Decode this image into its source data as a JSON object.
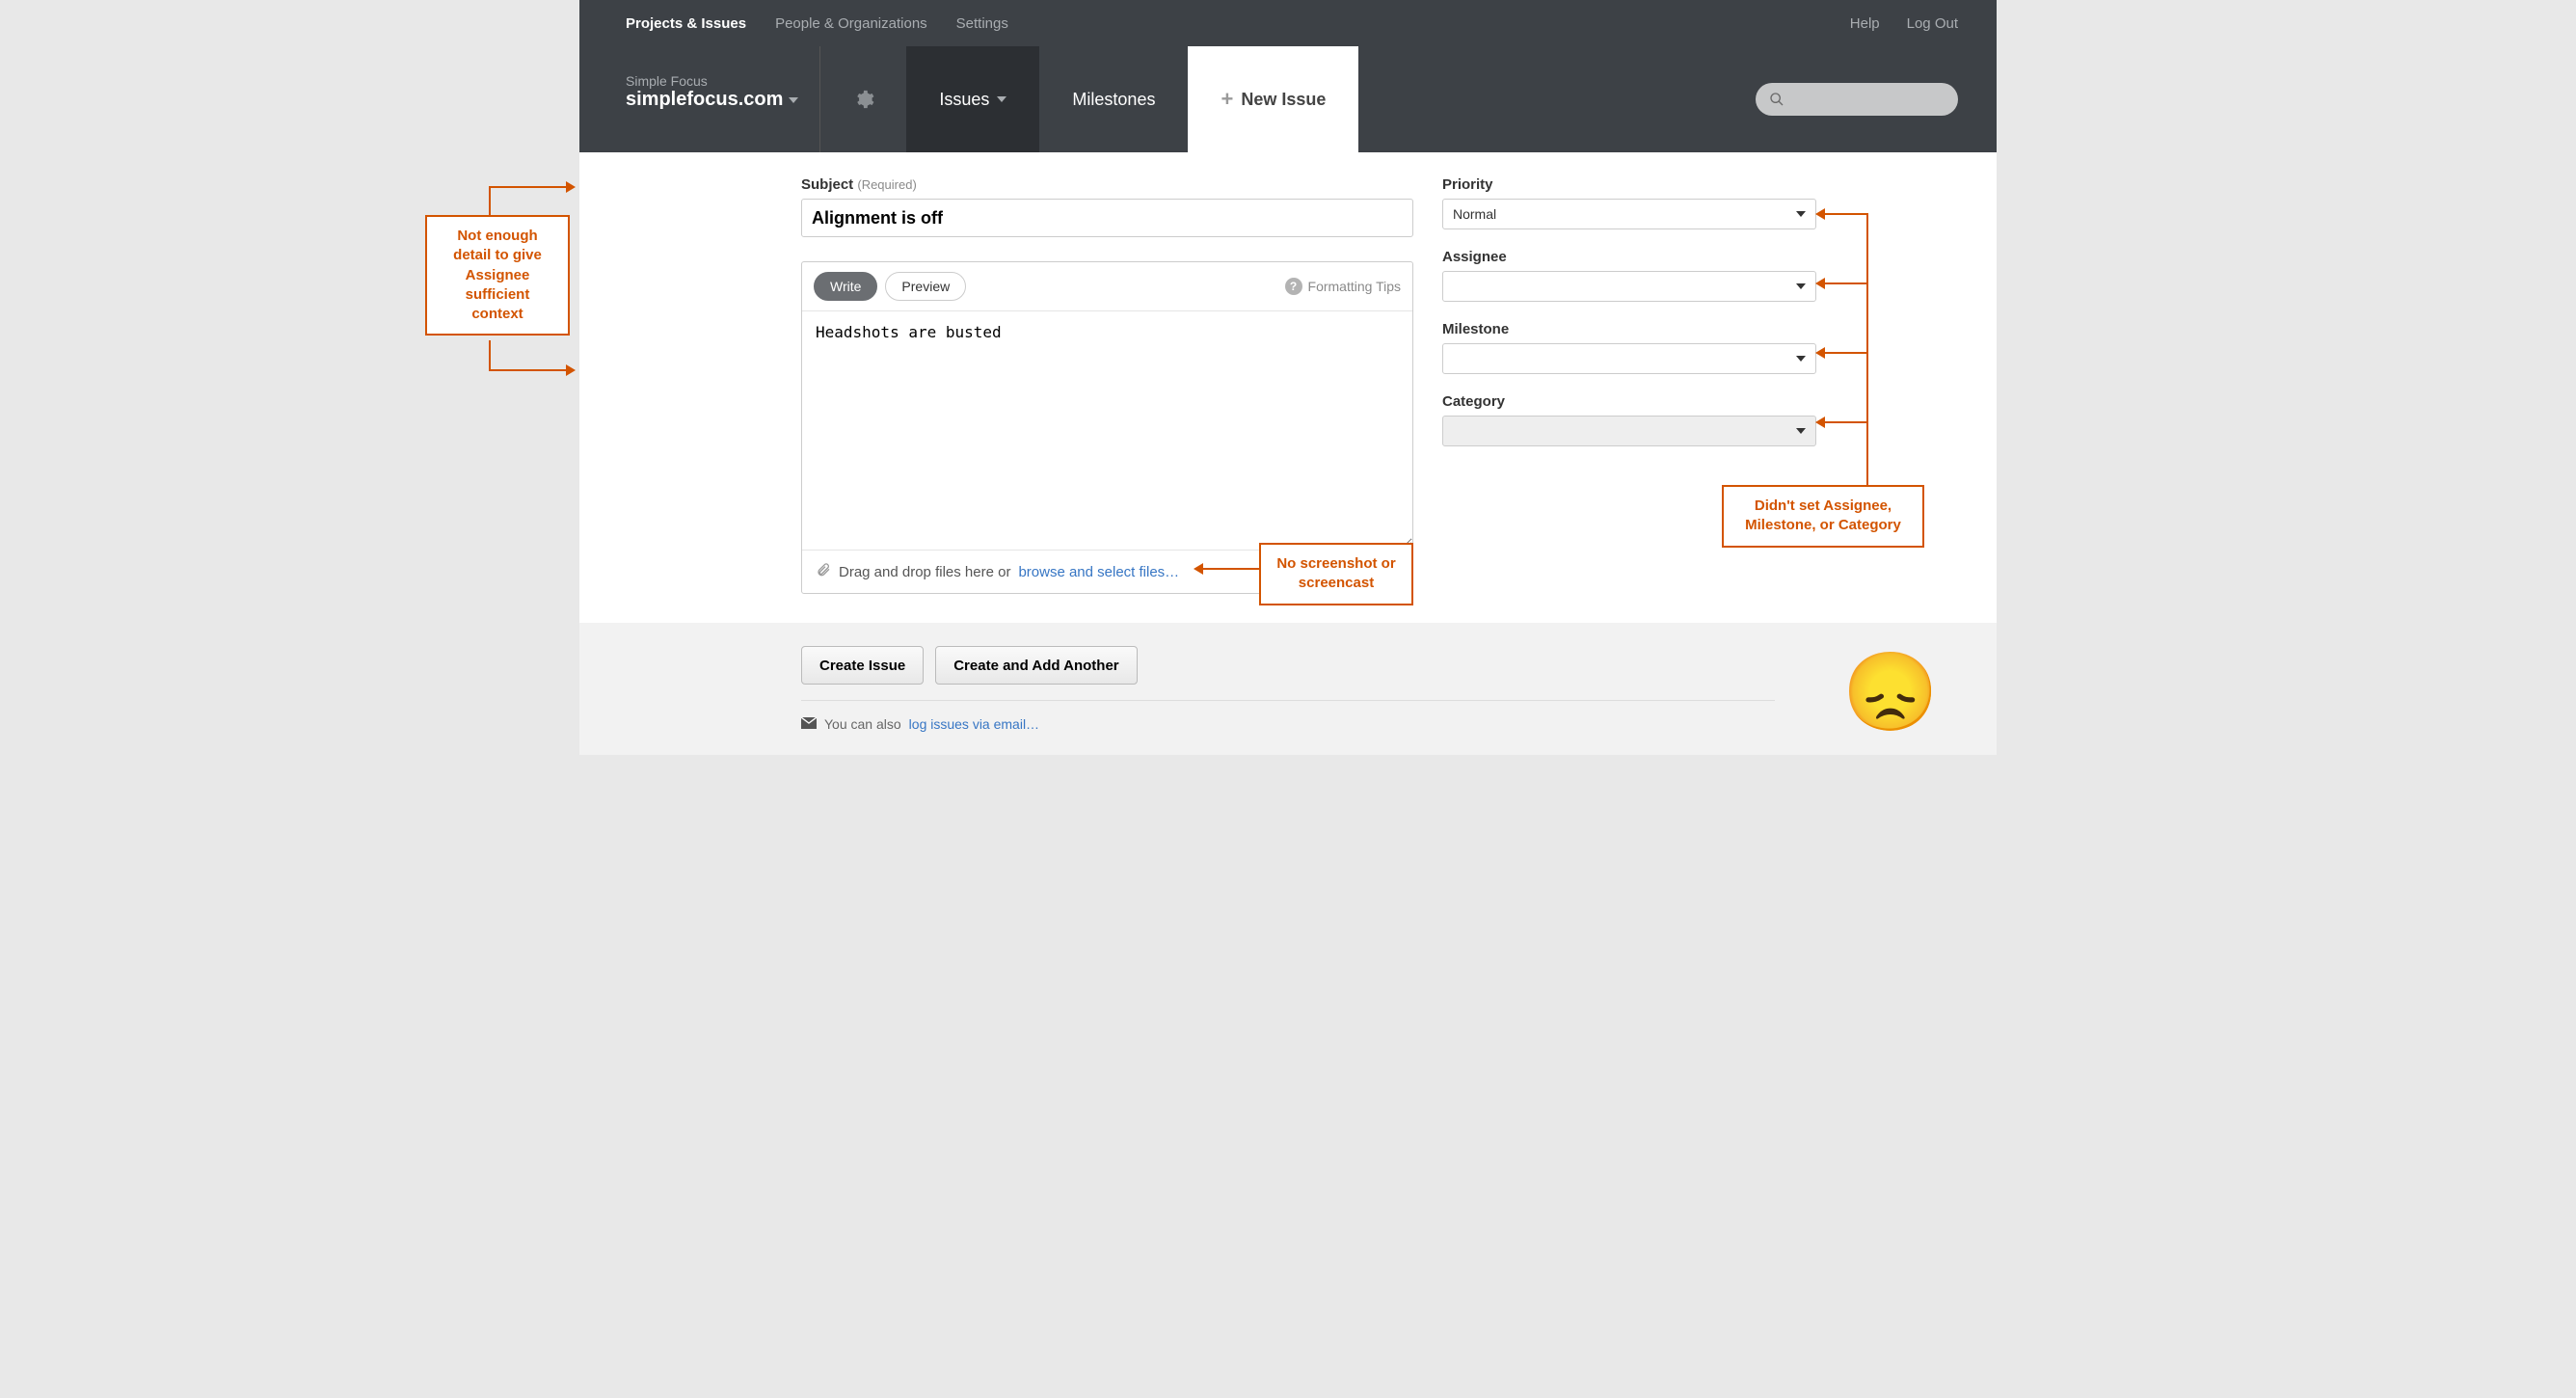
{
  "topnav": {
    "left": [
      "Projects & Issues",
      "People & Organizations",
      "Settings"
    ],
    "right": [
      "Help",
      "Log Out"
    ]
  },
  "workspace": {
    "org": "Simple Focus",
    "project": "simplefocus.com"
  },
  "tabs": {
    "issues": "Issues",
    "milestones": "Milestones",
    "newissue": "New Issue"
  },
  "search": {
    "placeholder": ""
  },
  "form": {
    "subject_label": "Subject",
    "subject_req": "(Required)",
    "subject_value": "Alignment is off",
    "write": "Write",
    "preview": "Preview",
    "formatting_tips": "Formatting Tips",
    "body": "Headshots are busted",
    "drop_prefix": "Drag and drop files here or ",
    "drop_link": "browse and select files…"
  },
  "sidebar": {
    "priority_label": "Priority",
    "priority_value": "Normal",
    "assignee_label": "Assignee",
    "assignee_value": "",
    "milestone_label": "Milestone",
    "milestone_value": "",
    "category_label": "Category",
    "category_value": ""
  },
  "buttons": {
    "create": "Create Issue",
    "create_another": "Create and Add Another"
  },
  "emailline": {
    "prefix": "You can also ",
    "link": "log issues via email…"
  },
  "annotations": {
    "left": "Not enough detail to give Assignee sufficient context",
    "mid": "No screenshot or screencast",
    "right": "Didn't set Assignee, Milestone, or Category"
  },
  "emoji": "😞"
}
